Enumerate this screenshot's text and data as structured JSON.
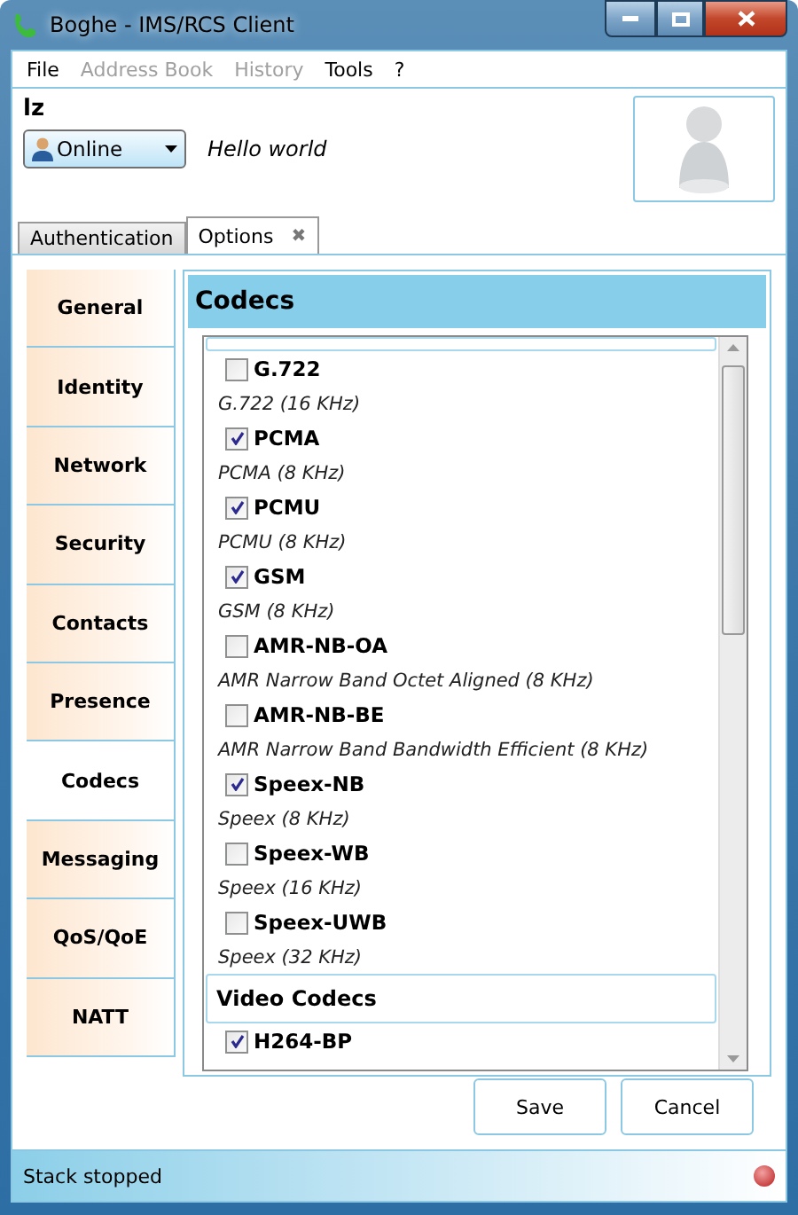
{
  "window": {
    "title": "Boghe - IMS/RCS Client"
  },
  "menu": [
    {
      "label": "File",
      "disabled": false
    },
    {
      "label": "Address Book",
      "disabled": true
    },
    {
      "label": "History",
      "disabled": true
    },
    {
      "label": "Tools",
      "disabled": false
    },
    {
      "label": "?",
      "disabled": false
    }
  ],
  "user": {
    "name": "lz",
    "status": "Online",
    "mood": "Hello world"
  },
  "tabs": [
    {
      "label": "Authentication",
      "selected": false
    },
    {
      "label": "Options",
      "selected": true,
      "close": "✖"
    }
  ],
  "sidebar": {
    "items": [
      {
        "label": "General",
        "selected": false
      },
      {
        "label": "Identity",
        "selected": false
      },
      {
        "label": "Network",
        "selected": false
      },
      {
        "label": "Security",
        "selected": false
      },
      {
        "label": "Contacts",
        "selected": false
      },
      {
        "label": "Presence",
        "selected": false
      },
      {
        "label": "Codecs",
        "selected": true
      },
      {
        "label": "Messaging",
        "selected": false
      },
      {
        "label": "QoS/QoE",
        "selected": false
      },
      {
        "label": "NATT",
        "selected": false
      }
    ]
  },
  "panel": {
    "title": "Codecs",
    "sections": [
      {
        "codecs": [
          {
            "name": "G.722",
            "description": "G.722 (16 KHz)",
            "checked": false
          },
          {
            "name": "PCMA",
            "description": "PCMA (8 KHz)",
            "checked": true
          },
          {
            "name": "PCMU",
            "description": "PCMU (8 KHz)",
            "checked": true
          },
          {
            "name": "GSM",
            "description": "GSM (8 KHz)",
            "checked": true
          },
          {
            "name": "AMR-NB-OA",
            "description": "AMR Narrow Band Octet Aligned (8 KHz)",
            "checked": false
          },
          {
            "name": "AMR-NB-BE",
            "description": "AMR Narrow Band Bandwidth Efficient (8 KHz)",
            "checked": false
          },
          {
            "name": "Speex-NB",
            "description": "Speex (8 KHz)",
            "checked": true
          },
          {
            "name": "Speex-WB",
            "description": "Speex (16 KHz)",
            "checked": false
          },
          {
            "name": "Speex-UWB",
            "description": "Speex (32 KHz)",
            "checked": false
          }
        ]
      },
      {
        "title": "Video Codecs",
        "codecs": [
          {
            "name": "H264-BP",
            "checked": true
          }
        ]
      }
    ]
  },
  "buttons": [
    "Save",
    "Cancel"
  ],
  "status_bar": {
    "text": "Stack stopped",
    "stack_running": false
  }
}
